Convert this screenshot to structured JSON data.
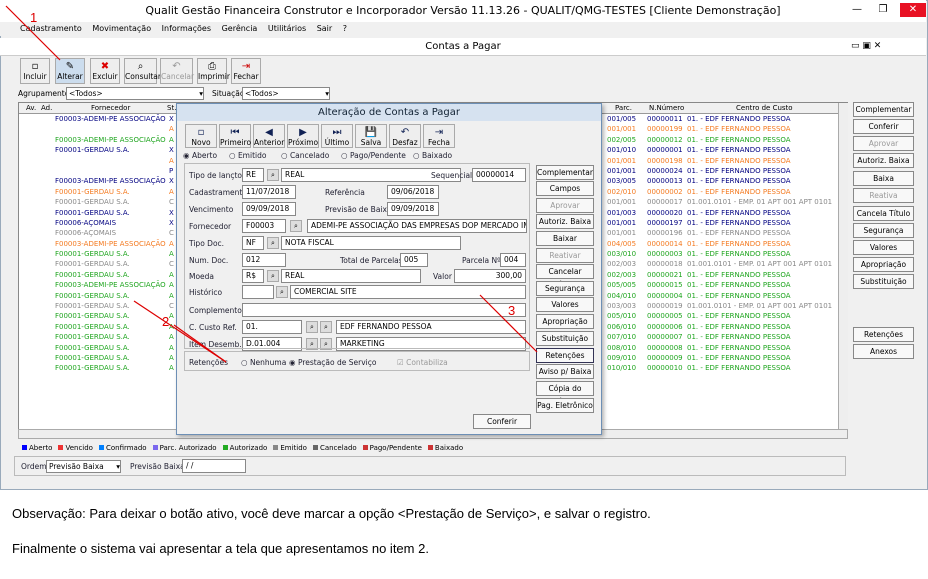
{
  "window": {
    "title": "Qualit Gestão Financeira Construtor e Incorporador Versão 11.13.26 - QUALIT/QMG-TESTES [Cliente Demonstração]"
  },
  "menu": [
    "Cadastramento",
    "Movimentação",
    "Informações",
    "Gerência",
    "Utilitários",
    "Sair",
    "?"
  ],
  "child": {
    "title": "Contas a Pagar"
  },
  "toolbar": [
    "Incluir",
    "Alterar",
    "Excluir",
    "Consultar",
    "Cancelar",
    "Imprimir",
    "Fechar"
  ],
  "filters": {
    "agrupamento_label": "Agrupamento",
    "agrupamento_value": "<Todos>",
    "situacao_label": "Situação",
    "situacao_value": "<Todos>"
  },
  "grid": {
    "headers": [
      "Av.",
      "Ad.",
      "Fornecedor",
      "St.",
      "Parc.",
      "N.Número",
      "Centro de Custo"
    ],
    "rows": [
      {
        "forn": "F00003-ADEMI-PE ASSOCIAÇÃO",
        "st": "X",
        "parc": "001/005",
        "num": "00000011",
        "cc": "01. - EDF FERNANDO PESSOA",
        "color": "darkblue"
      },
      {
        "forn": "",
        "st": "A",
        "parc": "001/001",
        "num": "00000199",
        "cc": "01. - EDF FERNANDO PESSOA",
        "color": "orange"
      },
      {
        "forn": "F00003-ADEMI-PE ASSOCIAÇÃO",
        "st": "A",
        "parc": "002/005",
        "num": "00000012",
        "cc": "01. - EDF FERNANDO PESSOA",
        "color": "green"
      },
      {
        "forn": "F00001-GERDAU S.A.",
        "st": "X",
        "parc": "001/010",
        "num": "00000001",
        "cc": "01. - EDF FERNANDO PESSOA",
        "color": "darkblue"
      },
      {
        "forn": "",
        "st": "A",
        "parc": "001/001",
        "num": "00000198",
        "cc": "01. - EDF FERNANDO PESSOA",
        "color": "orange"
      },
      {
        "forn": "",
        "st": "P",
        "parc": "001/001",
        "num": "00000024",
        "cc": "01. - EDF FERNANDO PESSOA",
        "color": "darkblue"
      },
      {
        "forn": "F00003-ADEMI-PE ASSOCIAÇÃO",
        "st": "X",
        "parc": "003/005",
        "num": "00000013",
        "cc": "01. - EDF FERNANDO PESSOA",
        "color": "darkblue"
      },
      {
        "forn": "F00001-GERDAU S.A.",
        "st": "A",
        "parc": "002/010",
        "num": "00000002",
        "cc": "01. - EDF FERNANDO PESSOA",
        "color": "orange"
      },
      {
        "forn": "F00001-GERDAU S.A.",
        "st": "C",
        "parc": "001/001",
        "num": "00000017",
        "cc": "01.001.0101 - EMP. 01 APT 001 APT 0101",
        "color": "gray"
      },
      {
        "forn": "F00001-GERDAU S.A.",
        "st": "X",
        "parc": "001/003",
        "num": "00000020",
        "cc": "01. - EDF FERNANDO PESSOA",
        "color": "darkblue"
      },
      {
        "forn": "F00006-AÇOMAIS",
        "st": "X",
        "parc": "001/001",
        "num": "00000197",
        "cc": "01. - EDF FERNANDO PESSOA",
        "color": "darkblue"
      },
      {
        "forn": "F00006-AÇOMAIS",
        "st": "C",
        "parc": "001/001",
        "num": "00000196",
        "cc": "01. - EDF FERNANDO PESSOA",
        "color": "gray"
      },
      {
        "forn": "F00003-ADEMI-PE ASSOCIAÇÃO",
        "st": "A",
        "parc": "004/005",
        "num": "00000014",
        "cc": "01. - EDF FERNANDO PESSOA",
        "color": "orange"
      },
      {
        "forn": "F00001-GERDAU S.A.",
        "st": "A",
        "parc": "003/010",
        "num": "00000003",
        "cc": "01. - EDF FERNANDO PESSOA",
        "color": "green"
      },
      {
        "forn": "F00001-GERDAU S.A.",
        "st": "C",
        "parc": "002/003",
        "num": "00000018",
        "cc": "01.001.0101 - EMP. 01 APT 001 APT 0101",
        "color": "gray"
      },
      {
        "forn": "F00001-GERDAU S.A.",
        "st": "A",
        "parc": "002/003",
        "num": "00000021",
        "cc": "01. - EDF FERNANDO PESSOA",
        "color": "green"
      },
      {
        "forn": "F00003-ADEMI-PE ASSOCIAÇÃO",
        "st": "A",
        "parc": "005/005",
        "num": "00000015",
        "cc": "01. - EDF FERNANDO PESSOA",
        "color": "green"
      },
      {
        "forn": "F00001-GERDAU S.A.",
        "st": "A",
        "parc": "004/010",
        "num": "00000004",
        "cc": "01. - EDF FERNANDO PESSOA",
        "color": "green"
      },
      {
        "forn": "F00001-GERDAU S.A.",
        "st": "C",
        "parc": "003/003",
        "num": "00000019",
        "cc": "01.001.0101 - EMP. 01 APT 001 APT 0101",
        "color": "gray"
      },
      {
        "forn": "F00001-GERDAU S.A.",
        "st": "A",
        "parc": "005/010",
        "num": "00000005",
        "cc": "01. - EDF FERNANDO PESSOA",
        "color": "green"
      },
      {
        "forn": "F00001-GERDAU S.A.",
        "st": "A",
        "parc": "006/010",
        "num": "00000006",
        "cc": "01. - EDF FERNANDO PESSOA",
        "color": "green"
      },
      {
        "forn": "F00001-GERDAU S.A.",
        "st": "A",
        "parc": "007/010",
        "num": "00000007",
        "cc": "01. - EDF FERNANDO PESSOA",
        "color": "green"
      },
      {
        "forn": "F00001-GERDAU S.A.",
        "st": "A",
        "parc": "008/010",
        "num": "00000008",
        "cc": "01. - EDF FERNANDO PESSOA",
        "color": "green"
      },
      {
        "forn": "F00001-GERDAU S.A.",
        "st": "A",
        "parc": "009/010",
        "num": "00000009",
        "cc": "01. - EDF FERNANDO PESSOA",
        "color": "green"
      },
      {
        "forn": "F00001-GERDAU S.A.",
        "st": "A",
        "parc": "010/010",
        "num": "00000010",
        "cc": "01. - EDF FERNANDO PESSOA",
        "color": "green"
      }
    ]
  },
  "right_buttons": [
    {
      "label": "Complementar",
      "dis": false
    },
    {
      "label": "Conferir",
      "dis": false
    },
    {
      "label": "Aprovar",
      "dis": true
    },
    {
      "label": "Autoriz. Baixa",
      "dis": false
    },
    {
      "label": "Baixa",
      "dis": false
    },
    {
      "label": "Reativa",
      "dis": true
    },
    {
      "label": "Cancela Título",
      "dis": false
    },
    {
      "label": "Segurança",
      "dis": false
    },
    {
      "label": "Valores",
      "dis": false
    },
    {
      "label": "Apropriação",
      "dis": false
    },
    {
      "label": "Substituição",
      "dis": false
    },
    {
      "label": "Retenções",
      "dis": false
    },
    {
      "label": "Anexos",
      "dis": false
    }
  ],
  "dialog": {
    "title": "Alteração de Contas a Pagar",
    "nav": [
      "Novo",
      "Primeiro",
      "Anterior",
      "Próximo",
      "Último",
      "Salva",
      "Desfaz",
      "Fecha"
    ],
    "status_options": [
      "Aberto",
      "Emitido",
      "Cancelado",
      "Pago/Pendente",
      "Baixado"
    ],
    "labels": {
      "tipo": "Tipo de lançto.",
      "sequencial": "Sequencial",
      "cadastramento": "Cadastramento",
      "referencia": "Referência",
      "vencimento": "Vencimento",
      "previsao": "Previsão de Baixa",
      "fornecedor": "Fornecedor",
      "tipodoc": "Tipo Doc.",
      "numdoc": "Num. Doc.",
      "totparc": "Total de Parcelas",
      "parcela": "Parcela Nº",
      "moeda": "Moeda",
      "valor": "Valor",
      "historico": "Histórico",
      "complemento": "Complemento",
      "ccusto": "C. Custo Ref.",
      "item": "Item Desemb.",
      "retencoes": "Retenções",
      "ret_nenhuma": "Nenhuma",
      "ret_prest": "Prestação de Serviço",
      "contabiliza": "Contabiliza"
    },
    "values": {
      "tipo_code": "RE",
      "tipo_name": "REAL",
      "sequencial": "00000014",
      "cadastramento": "11/07/2018",
      "referencia": "09/06/2018",
      "vencimento": "09/09/2018",
      "previsao": "09/09/2018",
      "forn_code": "F00003",
      "forn_name": "ADEMI-PE ASSOCIAÇÃO DAS EMPRESAS DOP MERCADO IMOB",
      "tipodoc_code": "NF",
      "tipodoc_name": "NOTA FISCAL",
      "numdoc": "012",
      "totparc": "005",
      "parcela": "004",
      "moeda_code": "R$",
      "moeda_name": "REAL",
      "valor": "300,00",
      "historico": "COMERCIAL SITE",
      "complemento": "",
      "cc_code": "01.",
      "cc_name": "EDF FERNANDO PESSOA",
      "item_code": "D.01.004",
      "item_name": "MARKETING"
    },
    "side_buttons": [
      {
        "label": "Complementar",
        "dis": false
      },
      {
        "label": "Campos Extras",
        "dis": false
      },
      {
        "label": "Aprovar",
        "dis": true
      },
      {
        "label": "Autoriz. Baixa",
        "dis": false
      },
      {
        "label": "Baixar",
        "dis": false
      },
      {
        "label": "Reativar",
        "dis": true
      },
      {
        "label": "Cancelar Título",
        "dis": false
      },
      {
        "label": "Segurança",
        "dis": false
      },
      {
        "label": "Valores",
        "dis": false
      },
      {
        "label": "Apropriação",
        "dis": false
      },
      {
        "label": "Substituição",
        "dis": false
      },
      {
        "label": "Retenções",
        "dis": false
      },
      {
        "label": "Aviso p/ Baixa",
        "dis": false
      },
      {
        "label": "Cópia do Título",
        "dis": false
      },
      {
        "label": "Pag. Eletrônico",
        "dis": false
      }
    ],
    "conferir": "Conferir"
  },
  "legend": [
    "Aberto",
    "Vencido",
    "Confirmado",
    "Parc. Autorizado",
    "Autorizado",
    "Emitido",
    "Cancelado",
    "Pago/Pendente",
    "Baixado"
  ],
  "order": {
    "label": "Ordem",
    "value": "Previsão Baixa",
    "field_label": "Previsão Baixa",
    "field_value": "/ /"
  },
  "annotations": [
    "1",
    "2",
    "3"
  ],
  "notes": [
    "Observação: Para deixar o botão ativo, você deve marcar a opção <Prestação de Serviço>, e salvar o registro.",
    "Finalmente o sistema vai apresentar a tela que apresentamos no item 2."
  ]
}
